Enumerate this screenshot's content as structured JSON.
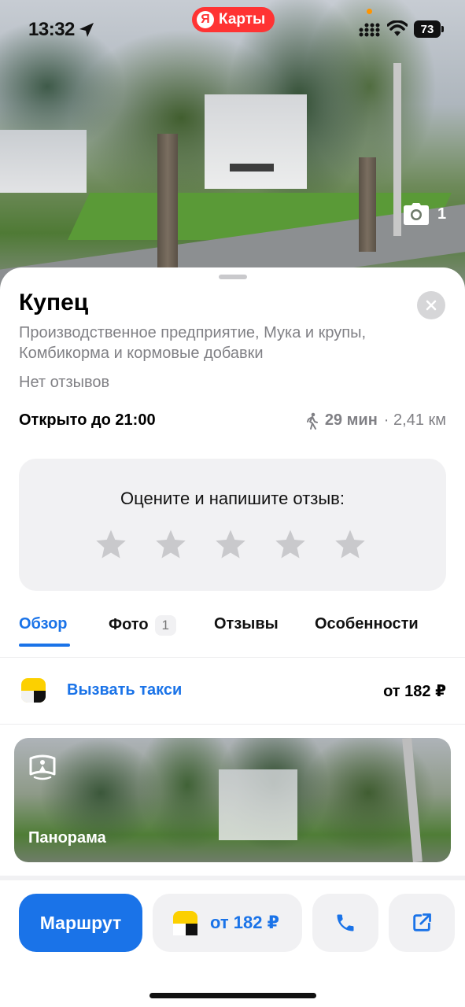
{
  "status_bar": {
    "time": "13:32",
    "battery": "73"
  },
  "brand": {
    "logo_letter": "Я",
    "name": "Карты"
  },
  "hero": {
    "photo_count": "1"
  },
  "place": {
    "title": "Купец",
    "categories": "Производственное предприятие, Мука и крупы, Комбикорма и кормовые добавки",
    "reviews_status": "Нет отзывов",
    "hours": "Открыто до 21:00",
    "walk_time": "29 мин",
    "distance": "· 2,41 км"
  },
  "rating": {
    "prompt": "Оцените и напишите отзыв:",
    "stars_total": 5,
    "selected": 0
  },
  "tabs": [
    {
      "label": "Обзор",
      "active": true
    },
    {
      "label": "Фото",
      "badge": "1"
    },
    {
      "label": "Отзывы"
    },
    {
      "label": "Особенности"
    }
  ],
  "taxi": {
    "label": "Вызвать такси",
    "price": "от 182 ₽"
  },
  "panorama": {
    "label": "Панорама"
  },
  "actions": {
    "route": "Маршрут",
    "taxi_price": "от 182 ₽",
    "call_icon": "phone-icon",
    "share_icon": "share-icon"
  },
  "colors": {
    "accent": "#1a73e8",
    "brand_red": "#ff3333",
    "taxi_yellow": "#fcd000",
    "muted_text": "#808085",
    "card_bg": "#f1f1f3"
  }
}
